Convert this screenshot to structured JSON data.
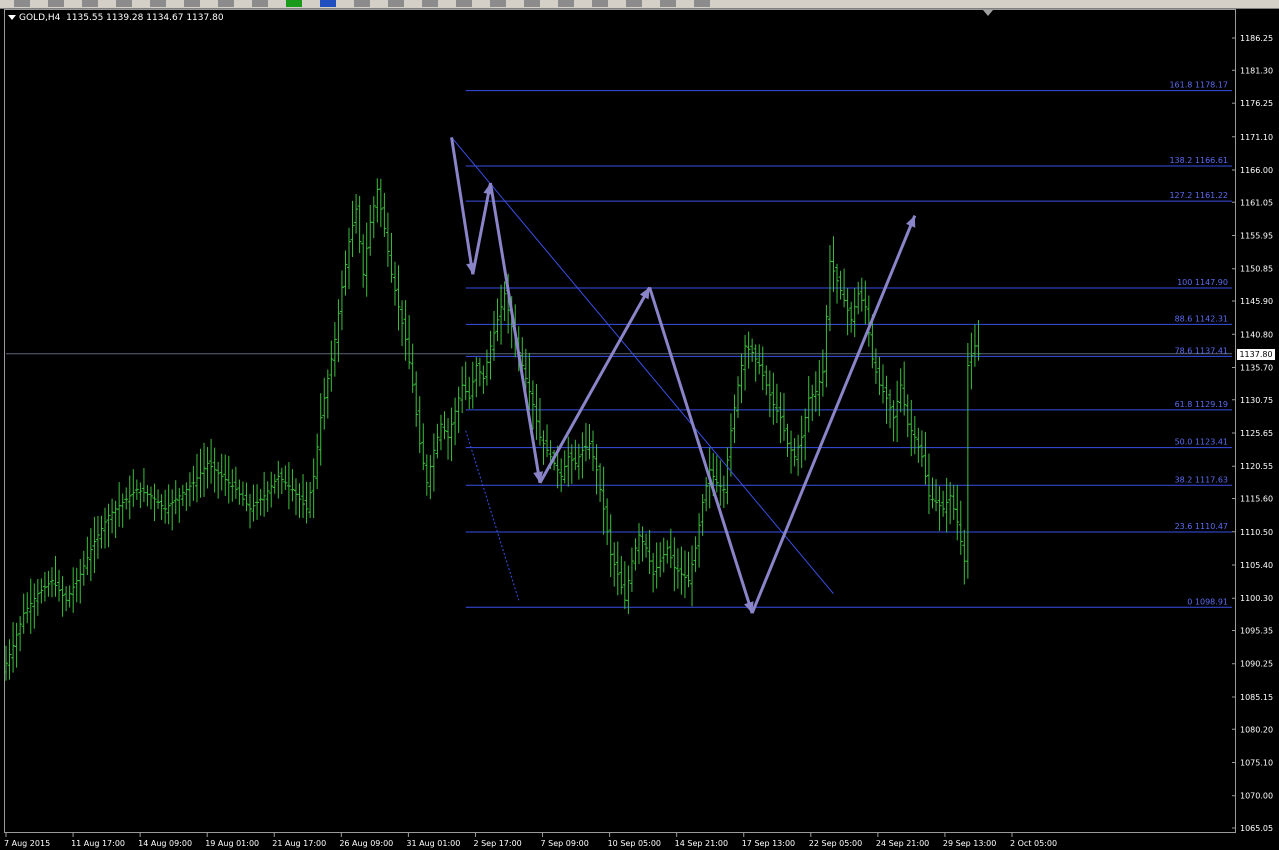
{
  "header": {
    "symbol_timeframe": "GOLD,H4",
    "ohlc": "1135.55 1139.28 1134.67 1137.80"
  },
  "current_price": "1137.80",
  "colors": {
    "background": "#000000",
    "candles": "#3cc03c",
    "axis_text": "#ffffff",
    "fib_lines": "#3a50e6",
    "fib_labels": "#5c6cf0",
    "trendline": "#3a50e6",
    "pattern_arrows": "#8a84c8",
    "crosshair": "#8090b0"
  },
  "toolbar": {
    "icons": [
      "arrow-icon",
      "new-chart-icon",
      "folder-icon",
      "profiles-icon",
      "market-watch-icon",
      "navigator-icon",
      "terminal-icon",
      "tester-icon",
      "new-order-icon",
      "autotrading-icon",
      "options-icon",
      "cursor-icon",
      "crosshair-icon",
      "vertical-line-icon",
      "horizontal-line-icon",
      "trendline-icon",
      "channel-icon",
      "fibonacci-icon",
      "text-icon",
      "label-icon",
      "zoom-icon"
    ]
  },
  "chart_data": {
    "type": "bar",
    "instrument": "GOLD",
    "timeframe": "H4",
    "y_axis_ticks": [
      "1186.25",
      "1181.30",
      "1176.25",
      "1171.10",
      "1166.00",
      "1161.05",
      "1155.95",
      "1150.85",
      "1145.90",
      "1140.80",
      "1135.70",
      "1130.75",
      "1125.65",
      "1120.55",
      "1115.60",
      "1110.50",
      "1105.40",
      "1100.30",
      "1095.35",
      "1090.25",
      "1085.15",
      "1080.20",
      "1075.10",
      "1070.00",
      "1065.05"
    ],
    "ylim": [
      1065.05,
      1186.25
    ],
    "x_axis_ticks": [
      "7 Aug 2015",
      "11 Aug 17:00",
      "14 Aug 09:00",
      "19 Aug 01:00",
      "21 Aug 17:00",
      "26 Aug 09:00",
      "31 Aug 01:00",
      "2 Sep 17:00",
      "7 Sep 09:00",
      "10 Sep 05:00",
      "14 Sep 21:00",
      "17 Sep 13:00",
      "22 Sep 05:00",
      "24 Sep 21:00",
      "29 Sep 13:00",
      "2 Oct 05:00"
    ],
    "price_path": [
      [
        0,
        1089
      ],
      [
        3,
        1093
      ],
      [
        6,
        1098
      ],
      [
        10,
        1101
      ],
      [
        14,
        1103
      ],
      [
        18,
        1100
      ],
      [
        22,
        1104
      ],
      [
        26,
        1109
      ],
      [
        30,
        1113
      ],
      [
        34,
        1115
      ],
      [
        38,
        1117
      ],
      [
        42,
        1116
      ],
      [
        46,
        1114
      ],
      [
        50,
        1116
      ],
      [
        54,
        1118
      ],
      [
        58,
        1121
      ],
      [
        62,
        1119
      ],
      [
        66,
        1117
      ],
      [
        70,
        1114
      ],
      [
        74,
        1116
      ],
      [
        78,
        1119
      ],
      [
        82,
        1117
      ],
      [
        86,
        1114
      ],
      [
        88,
        1119
      ],
      [
        90,
        1128
      ],
      [
        92,
        1134
      ],
      [
        94,
        1140
      ],
      [
        96,
        1148
      ],
      [
        98,
        1155
      ],
      [
        100,
        1160
      ],
      [
        102,
        1150
      ],
      [
        104,
        1158
      ],
      [
        106,
        1163
      ],
      [
        108,
        1157
      ],
      [
        110,
        1150
      ],
      [
        112,
        1145
      ],
      [
        114,
        1140
      ],
      [
        116,
        1133
      ],
      [
        118,
        1124
      ],
      [
        120,
        1118
      ],
      [
        122,
        1123
      ],
      [
        124,
        1127
      ],
      [
        126,
        1125
      ],
      [
        128,
        1129
      ],
      [
        130,
        1133
      ],
      [
        132,
        1131
      ],
      [
        134,
        1136
      ],
      [
        136,
        1134
      ],
      [
        138,
        1139
      ],
      [
        140,
        1143
      ],
      [
        142,
        1147
      ],
      [
        144,
        1142
      ],
      [
        146,
        1138
      ],
      [
        148,
        1134
      ],
      [
        150,
        1130
      ],
      [
        152,
        1125
      ],
      [
        154,
        1123
      ],
      [
        156,
        1121
      ],
      [
        158,
        1119
      ],
      [
        160,
        1122
      ],
      [
        162,
        1121
      ],
      [
        164,
        1123
      ],
      [
        166,
        1124
      ],
      [
        168,
        1120
      ],
      [
        170,
        1114
      ],
      [
        172,
        1107
      ],
      [
        174,
        1104
      ],
      [
        176,
        1100
      ],
      [
        178,
        1106
      ],
      [
        180,
        1110
      ],
      [
        182,
        1108
      ],
      [
        184,
        1104
      ],
      [
        186,
        1106
      ],
      [
        188,
        1108
      ],
      [
        190,
        1105
      ],
      [
        192,
        1104
      ],
      [
        194,
        1103
      ],
      [
        196,
        1108
      ],
      [
        198,
        1115
      ],
      [
        200,
        1120
      ],
      [
        202,
        1118
      ],
      [
        204,
        1117
      ],
      [
        206,
        1126
      ],
      [
        208,
        1133
      ],
      [
        210,
        1139
      ],
      [
        212,
        1138
      ],
      [
        214,
        1136
      ],
      [
        216,
        1133
      ],
      [
        218,
        1130
      ],
      [
        220,
        1128
      ],
      [
        222,
        1124
      ],
      [
        224,
        1122
      ],
      [
        226,
        1125
      ],
      [
        228,
        1131
      ],
      [
        230,
        1132
      ],
      [
        232,
        1135
      ],
      [
        234,
        1152
      ],
      [
        236,
        1149
      ],
      [
        238,
        1146
      ],
      [
        240,
        1143
      ],
      [
        242,
        1147
      ],
      [
        244,
        1145
      ],
      [
        246,
        1137
      ],
      [
        248,
        1133
      ],
      [
        250,
        1131
      ],
      [
        252,
        1128
      ],
      [
        254,
        1133
      ],
      [
        256,
        1127
      ],
      [
        258,
        1125
      ],
      [
        260,
        1122
      ],
      [
        262,
        1116
      ],
      [
        264,
        1115
      ],
      [
        266,
        1114
      ],
      [
        268,
        1116
      ],
      [
        270,
        1112
      ],
      [
        272,
        1106
      ],
      [
        273,
        1136
      ],
      [
        275,
        1139
      ],
      [
        276,
        1137.8
      ]
    ],
    "fibonacci_levels": [
      {
        "level": "161.8",
        "price": 1178.17
      },
      {
        "level": "138.2",
        "price": 1166.61
      },
      {
        "level": "127.2",
        "price": 1161.22
      },
      {
        "level": "100",
        "price": 1147.9
      },
      {
        "level": "88.6",
        "price": 1142.31
      },
      {
        "level": "78.6",
        "price": 1137.41
      },
      {
        "level": "61.8",
        "price": 1129.19
      },
      {
        "level": "50.0",
        "price": 1123.41
      },
      {
        "level": "38.2",
        "price": 1117.63
      },
      {
        "level": "23.6",
        "price": 1110.47
      },
      {
        "level": "0",
        "price": 1098.91
      }
    ],
    "fib_label_format": "{level} {price}",
    "trendline": {
      "from": [
        126,
        1171
      ],
      "to": [
        234,
        1101
      ]
    },
    "dotted_line": {
      "from": [
        130,
        1126
      ],
      "to": [
        145,
        1100
      ]
    },
    "pattern_arrows": [
      {
        "from": [
          126,
          1171
        ],
        "to": [
          132,
          1150
        ]
      },
      {
        "from": [
          132,
          1150
        ],
        "to": [
          137,
          1164
        ]
      },
      {
        "from": [
          137,
          1164
        ],
        "to": [
          151,
          1118
        ]
      },
      {
        "from": [
          151,
          1118
        ],
        "to": [
          182,
          1148
        ]
      },
      {
        "from": [
          182,
          1148
        ],
        "to": [
          211,
          1098
        ]
      },
      {
        "from": [
          211,
          1098
        ],
        "to": [
          257,
          1159
        ]
      }
    ],
    "crosshair_price": 1137.8,
    "grid": false,
    "legend": "none"
  }
}
